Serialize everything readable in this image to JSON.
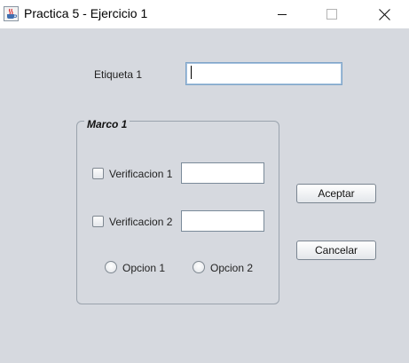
{
  "window": {
    "title": "Practica 5 - Ejercicio 1",
    "icon": "java-cup-icon"
  },
  "form": {
    "label1": "Etiqueta 1",
    "field1_value": ""
  },
  "group": {
    "title": "Marco 1",
    "check1_label": "Verificacion 1",
    "check1_checked": false,
    "check1_field_value": "",
    "check2_label": "Verificacion 2",
    "check2_checked": false,
    "check2_field_value": "",
    "radio1_label": "Opcion 1",
    "radio1_selected": false,
    "radio2_label": "Opcion 2",
    "radio2_selected": false
  },
  "buttons": {
    "accept": "Aceptar",
    "cancel": "Cancelar"
  },
  "colors": {
    "background": "#d6d9df",
    "titlebar": "#ffffff",
    "focus_border": "#7ea4c8"
  }
}
